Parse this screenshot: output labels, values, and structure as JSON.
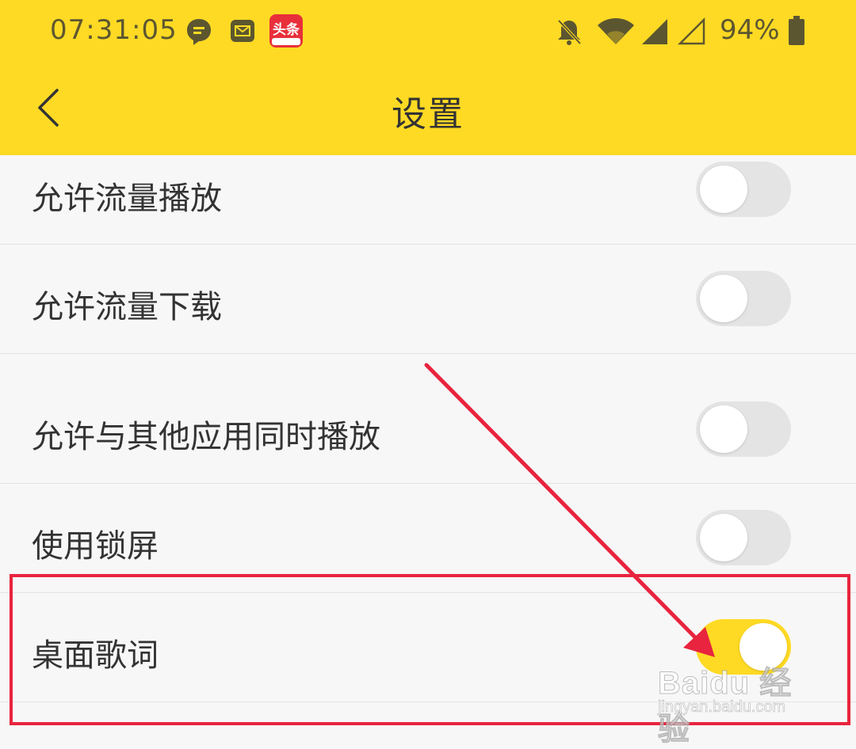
{
  "status_bar": {
    "time": "07:31:05",
    "battery": "94%",
    "app_badge_text": "头条",
    "icons": [
      "chat-bubble-icon",
      "mail-icon",
      "toutiao-app-icon",
      "bell-off-icon",
      "wifi-icon",
      "signal-full-icon",
      "signal-empty-icon",
      "battery-icon"
    ]
  },
  "header": {
    "title": "设置",
    "back_icon": "chevron-left-icon",
    "background": "#ffda24"
  },
  "settings": [
    {
      "label": "允许流量播放",
      "enabled": false
    },
    {
      "label": "允许流量下载",
      "enabled": false
    },
    {
      "label": "允许与其他应用同时播放",
      "enabled": false
    },
    {
      "label": "使用锁屏",
      "enabled": false
    },
    {
      "label": "桌面歌词",
      "enabled": true
    }
  ],
  "annotation": {
    "highlight_color": "#e8243e",
    "target": "桌面歌词"
  },
  "watermark": {
    "brand": "Baidu 经验",
    "url": "jingyan.baidu.com"
  }
}
